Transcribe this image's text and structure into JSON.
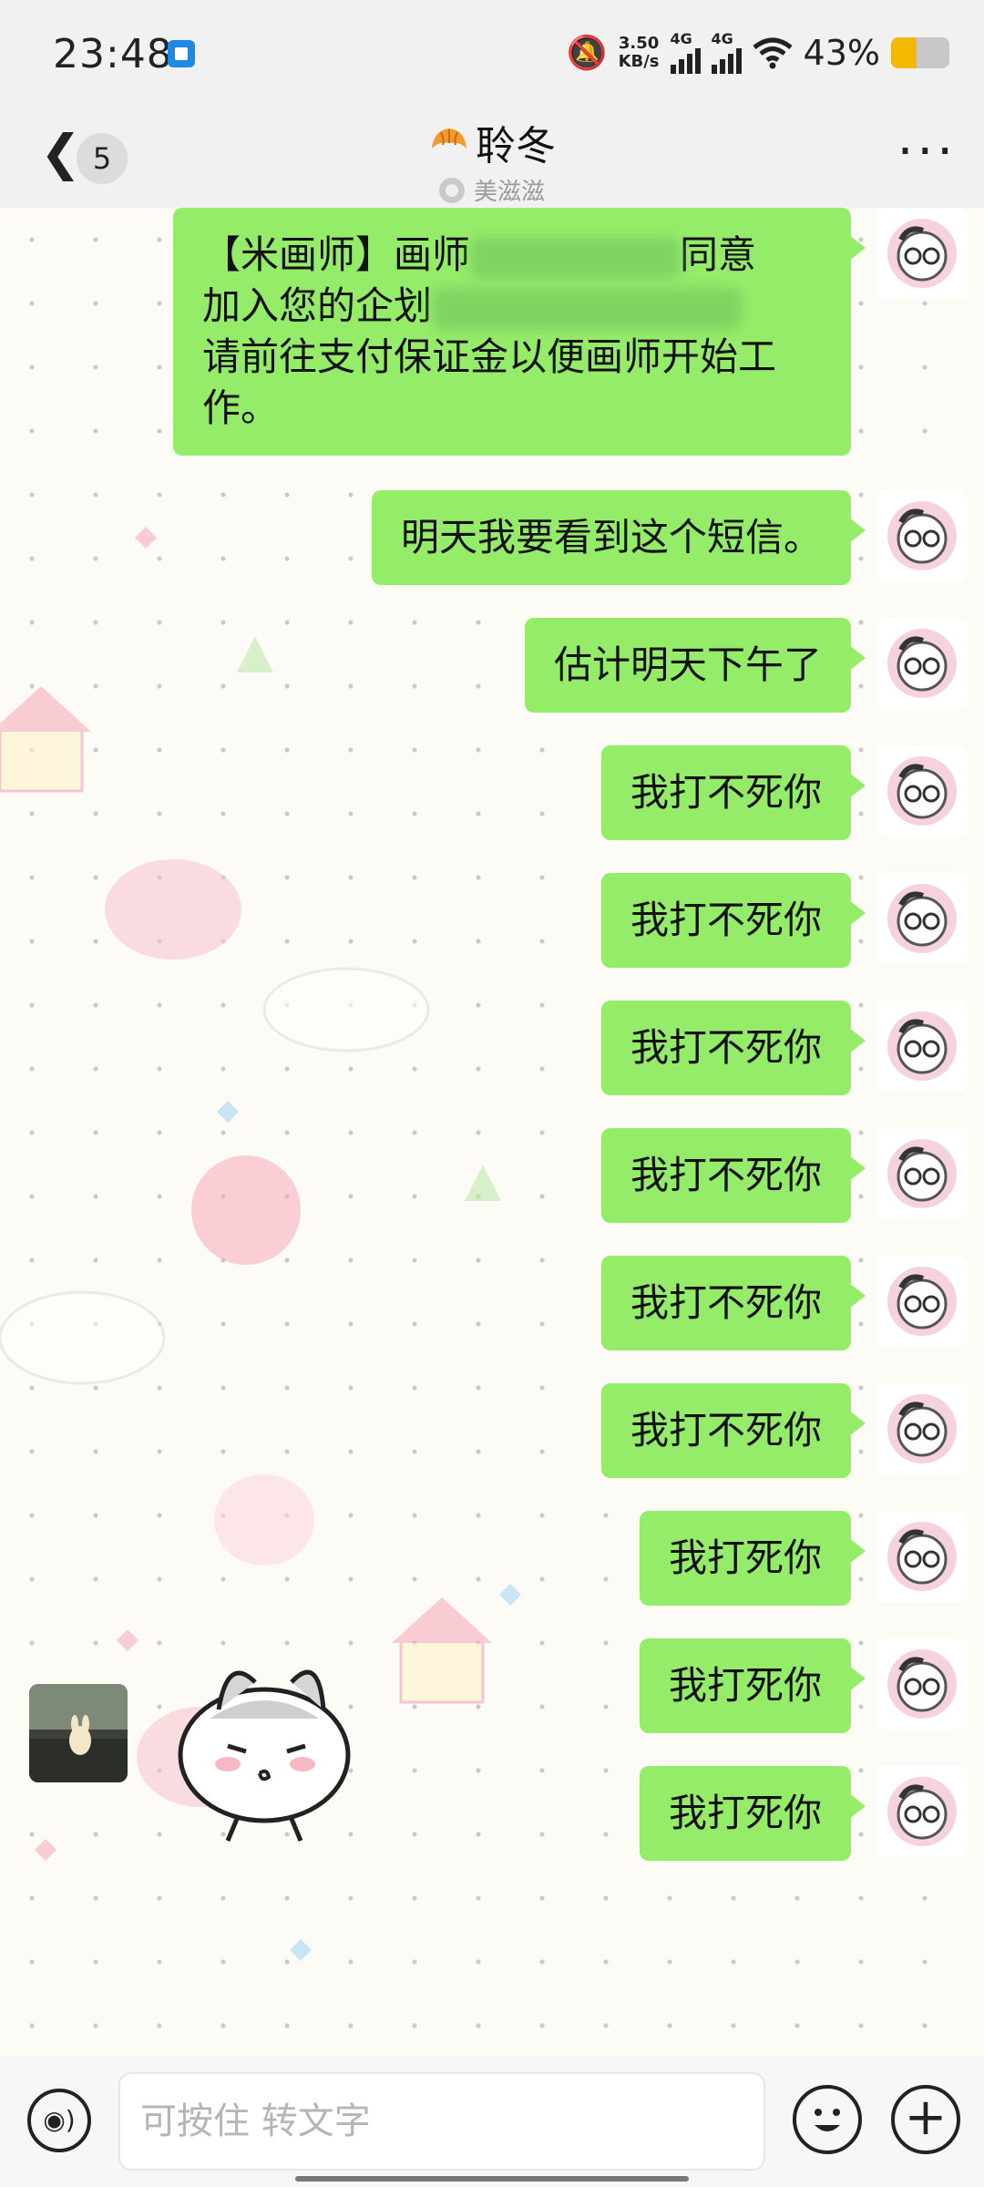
{
  "status_bar": {
    "time": "23:48",
    "network_speed_value": "3.50",
    "network_speed_unit": "KB/s",
    "signal_1_label": "4G",
    "signal_2_label": "4G",
    "battery_percent_text": "43%",
    "battery_level": 0.43,
    "battery_color": "#f5b800"
  },
  "header": {
    "back_icon": "chevron-left-icon",
    "unread_count": "5",
    "title": "聆冬",
    "subtitle": "美滋滋",
    "more_icon": "more-dots-icon"
  },
  "messages": [
    {
      "sender": "self",
      "text_lines": [
        "【米画师】画师",
        "同意",
        "加入您的企划",
        "请前往支付保证金以便画师开始工",
        "作。"
      ]
    },
    {
      "sender": "self",
      "text": "明天我要看到这个短信。"
    },
    {
      "sender": "self",
      "text": "估计明天下午了"
    },
    {
      "sender": "self",
      "text": "我打不死你"
    },
    {
      "sender": "self",
      "text": "我打不死你"
    },
    {
      "sender": "self",
      "text": "我打不死你"
    },
    {
      "sender": "self",
      "text": "我打不死你"
    },
    {
      "sender": "self",
      "text": "我打不死你"
    },
    {
      "sender": "self",
      "text": "我打不死你"
    },
    {
      "sender": "self",
      "text": "我打死你"
    },
    {
      "sender": "self",
      "text": "我打死你"
    },
    {
      "sender": "self",
      "text": "我打死你"
    }
  ],
  "input_bar": {
    "voice_icon": "voice-icon",
    "placeholder": "可按住 转文字",
    "emoji_icon": "emoji-icon",
    "plus_icon": "plus-icon"
  },
  "colors": {
    "bubble_self": "#95ec69",
    "header_bg": "#f1f1f1"
  }
}
